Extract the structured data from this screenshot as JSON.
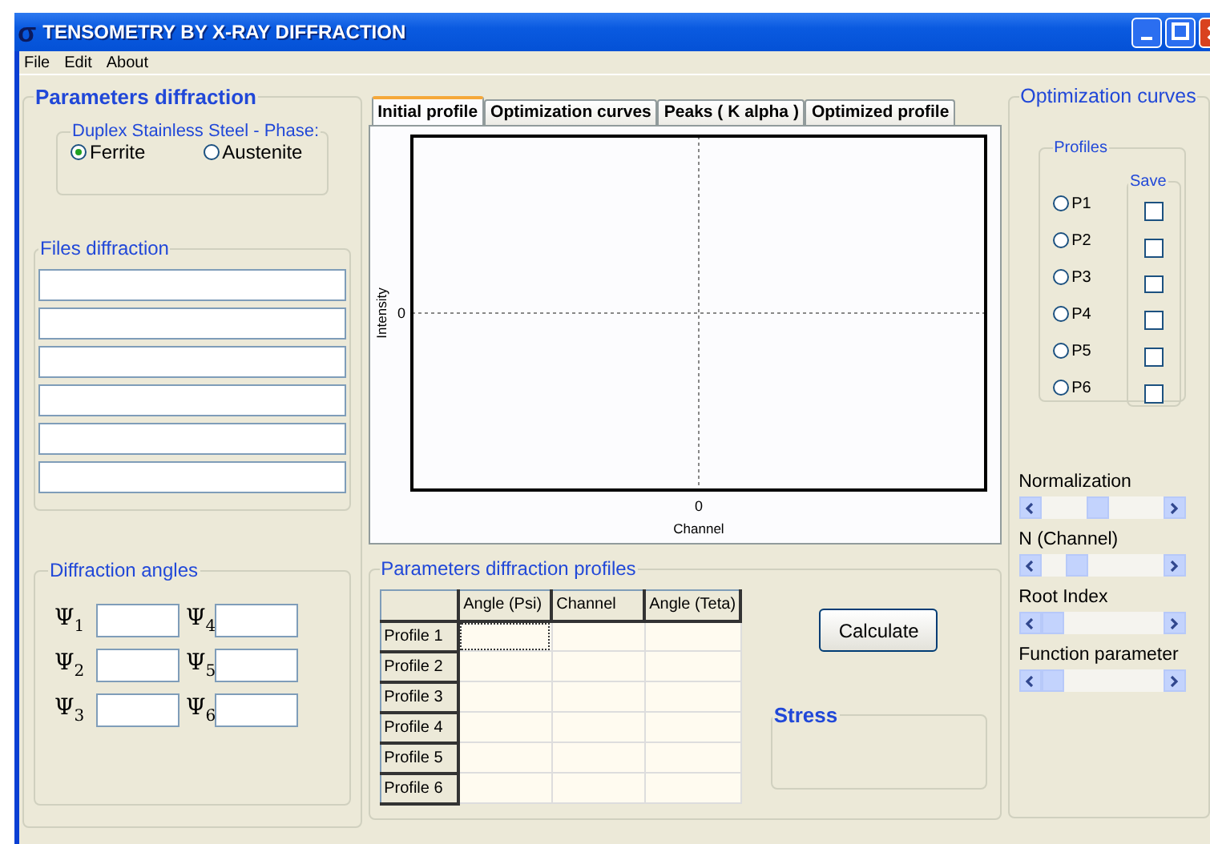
{
  "window": {
    "title": "TENSOMETRY BY X-RAY DIFFRACTION",
    "icon_glyph": "σ"
  },
  "menu": [
    "File",
    "Edit",
    "About"
  ],
  "parameters_panel": {
    "title": "Parameters diffraction",
    "phase_group": {
      "title": "Duplex Stainless Steel -  Phase:",
      "options": [
        {
          "label": "Ferrite",
          "selected": true
        },
        {
          "label": "Austenite",
          "selected": false
        }
      ]
    },
    "files_group": {
      "title": "Files diffraction"
    },
    "angles_group": {
      "title": "Diffraction angles",
      "angles": [
        "Ψ$_{1}$",
        "Ψ$_{4}$",
        "Ψ$_{2}$",
        "Ψ$_{5}$",
        "Ψ$_{3}$",
        "Ψ$_{6}$"
      ]
    }
  },
  "tabs": [
    {
      "label": "Initial profile",
      "selected": true
    },
    {
      "label": "Optimization curves",
      "selected": false
    },
    {
      "label": "Peaks ( K alpha )",
      "selected": false
    },
    {
      "label": "Optimized profile",
      "selected": false
    }
  ],
  "chart": {
    "x_axis_label": "Channel",
    "y_axis_label": "Intensity",
    "x_tick": "0",
    "y_tick": "0"
  },
  "profiles_panel": {
    "title": "Parameters diffraction profiles",
    "table": {
      "columns": [
        "Angle (Psi)",
        "Channel",
        "Angle (Teta)"
      ],
      "rows": [
        {
          "label": "Profile 1"
        },
        {
          "label": "Profile 2"
        },
        {
          "label": "Profile 3"
        },
        {
          "label": "Profile 4"
        },
        {
          "label": "Profile 5"
        },
        {
          "label": "Profile 6"
        }
      ]
    },
    "calculate_button": "Calculate",
    "stress_group": {
      "title": "Stress"
    }
  },
  "optimization_panel": {
    "title": "Optimization curves",
    "profiles_title": "Profiles",
    "save_title": "Save",
    "profiles": [
      {
        "label": "P1",
        "selected": false,
        "checked": false
      },
      {
        "label": "P2",
        "selected": false,
        "checked": false
      },
      {
        "label": "P3",
        "selected": false,
        "checked": false
      },
      {
        "label": "P4",
        "selected": false,
        "checked": false
      },
      {
        "label": "P5",
        "selected": false,
        "checked": false
      },
      {
        "label": "P6",
        "selected": false,
        "checked": false
      }
    ],
    "sliders": [
      {
        "label": "Normalization",
        "level": 0.45
      },
      {
        "label": "N (Channel)",
        "level": 0.25
      },
      {
        "label": "Root Index",
        "level": 0
      },
      {
        "label": "Function parameter",
        "level": 0
      }
    ]
  }
}
